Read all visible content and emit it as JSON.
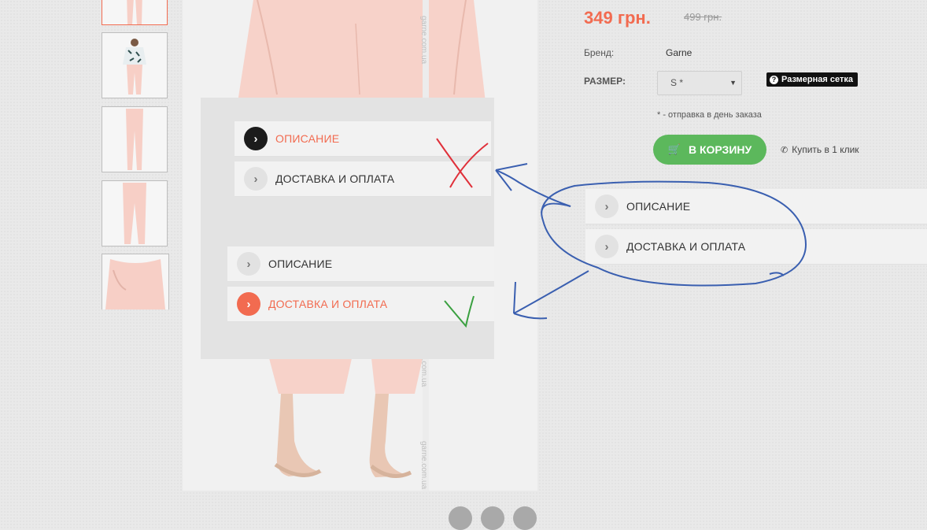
{
  "product": {
    "price": "349 грн.",
    "old_price": "499 грн.",
    "brand_label": "Бренд:",
    "brand_value": "Garne",
    "size_label": "РАЗМЕР:",
    "size_selected": "S *",
    "size_chart_label": "Размерная сетка",
    "note": "* - отправка в день заказа",
    "cart_button": "В КОРЗИНУ",
    "one_click": "Купить в 1 клик"
  },
  "accordion_wrong": {
    "items": [
      {
        "label": "ОПИСАНИЕ",
        "state": "active-dark"
      },
      {
        "label": "ДОСТАВКА И ОПЛАТА",
        "state": "inactive"
      }
    ]
  },
  "accordion_right": {
    "items": [
      {
        "label": "ОПИСАНИЕ",
        "state": "inactive"
      },
      {
        "label": "ДОСТАВКА И ОПЛАТА",
        "state": "active-orange"
      }
    ]
  },
  "accordion_original": {
    "items": [
      {
        "label": "ОПИСАНИЕ",
        "state": "inactive"
      },
      {
        "label": "ДОСТАВКА И ОПЛАТА",
        "state": "inactive"
      }
    ]
  },
  "watermark": "garne.com.ua",
  "colors": {
    "accent": "#f26b50",
    "cart_green": "#5cb85c",
    "annotation_blue": "#3a5fb0",
    "annotation_red": "#e0303a",
    "annotation_green": "#3aa040"
  }
}
